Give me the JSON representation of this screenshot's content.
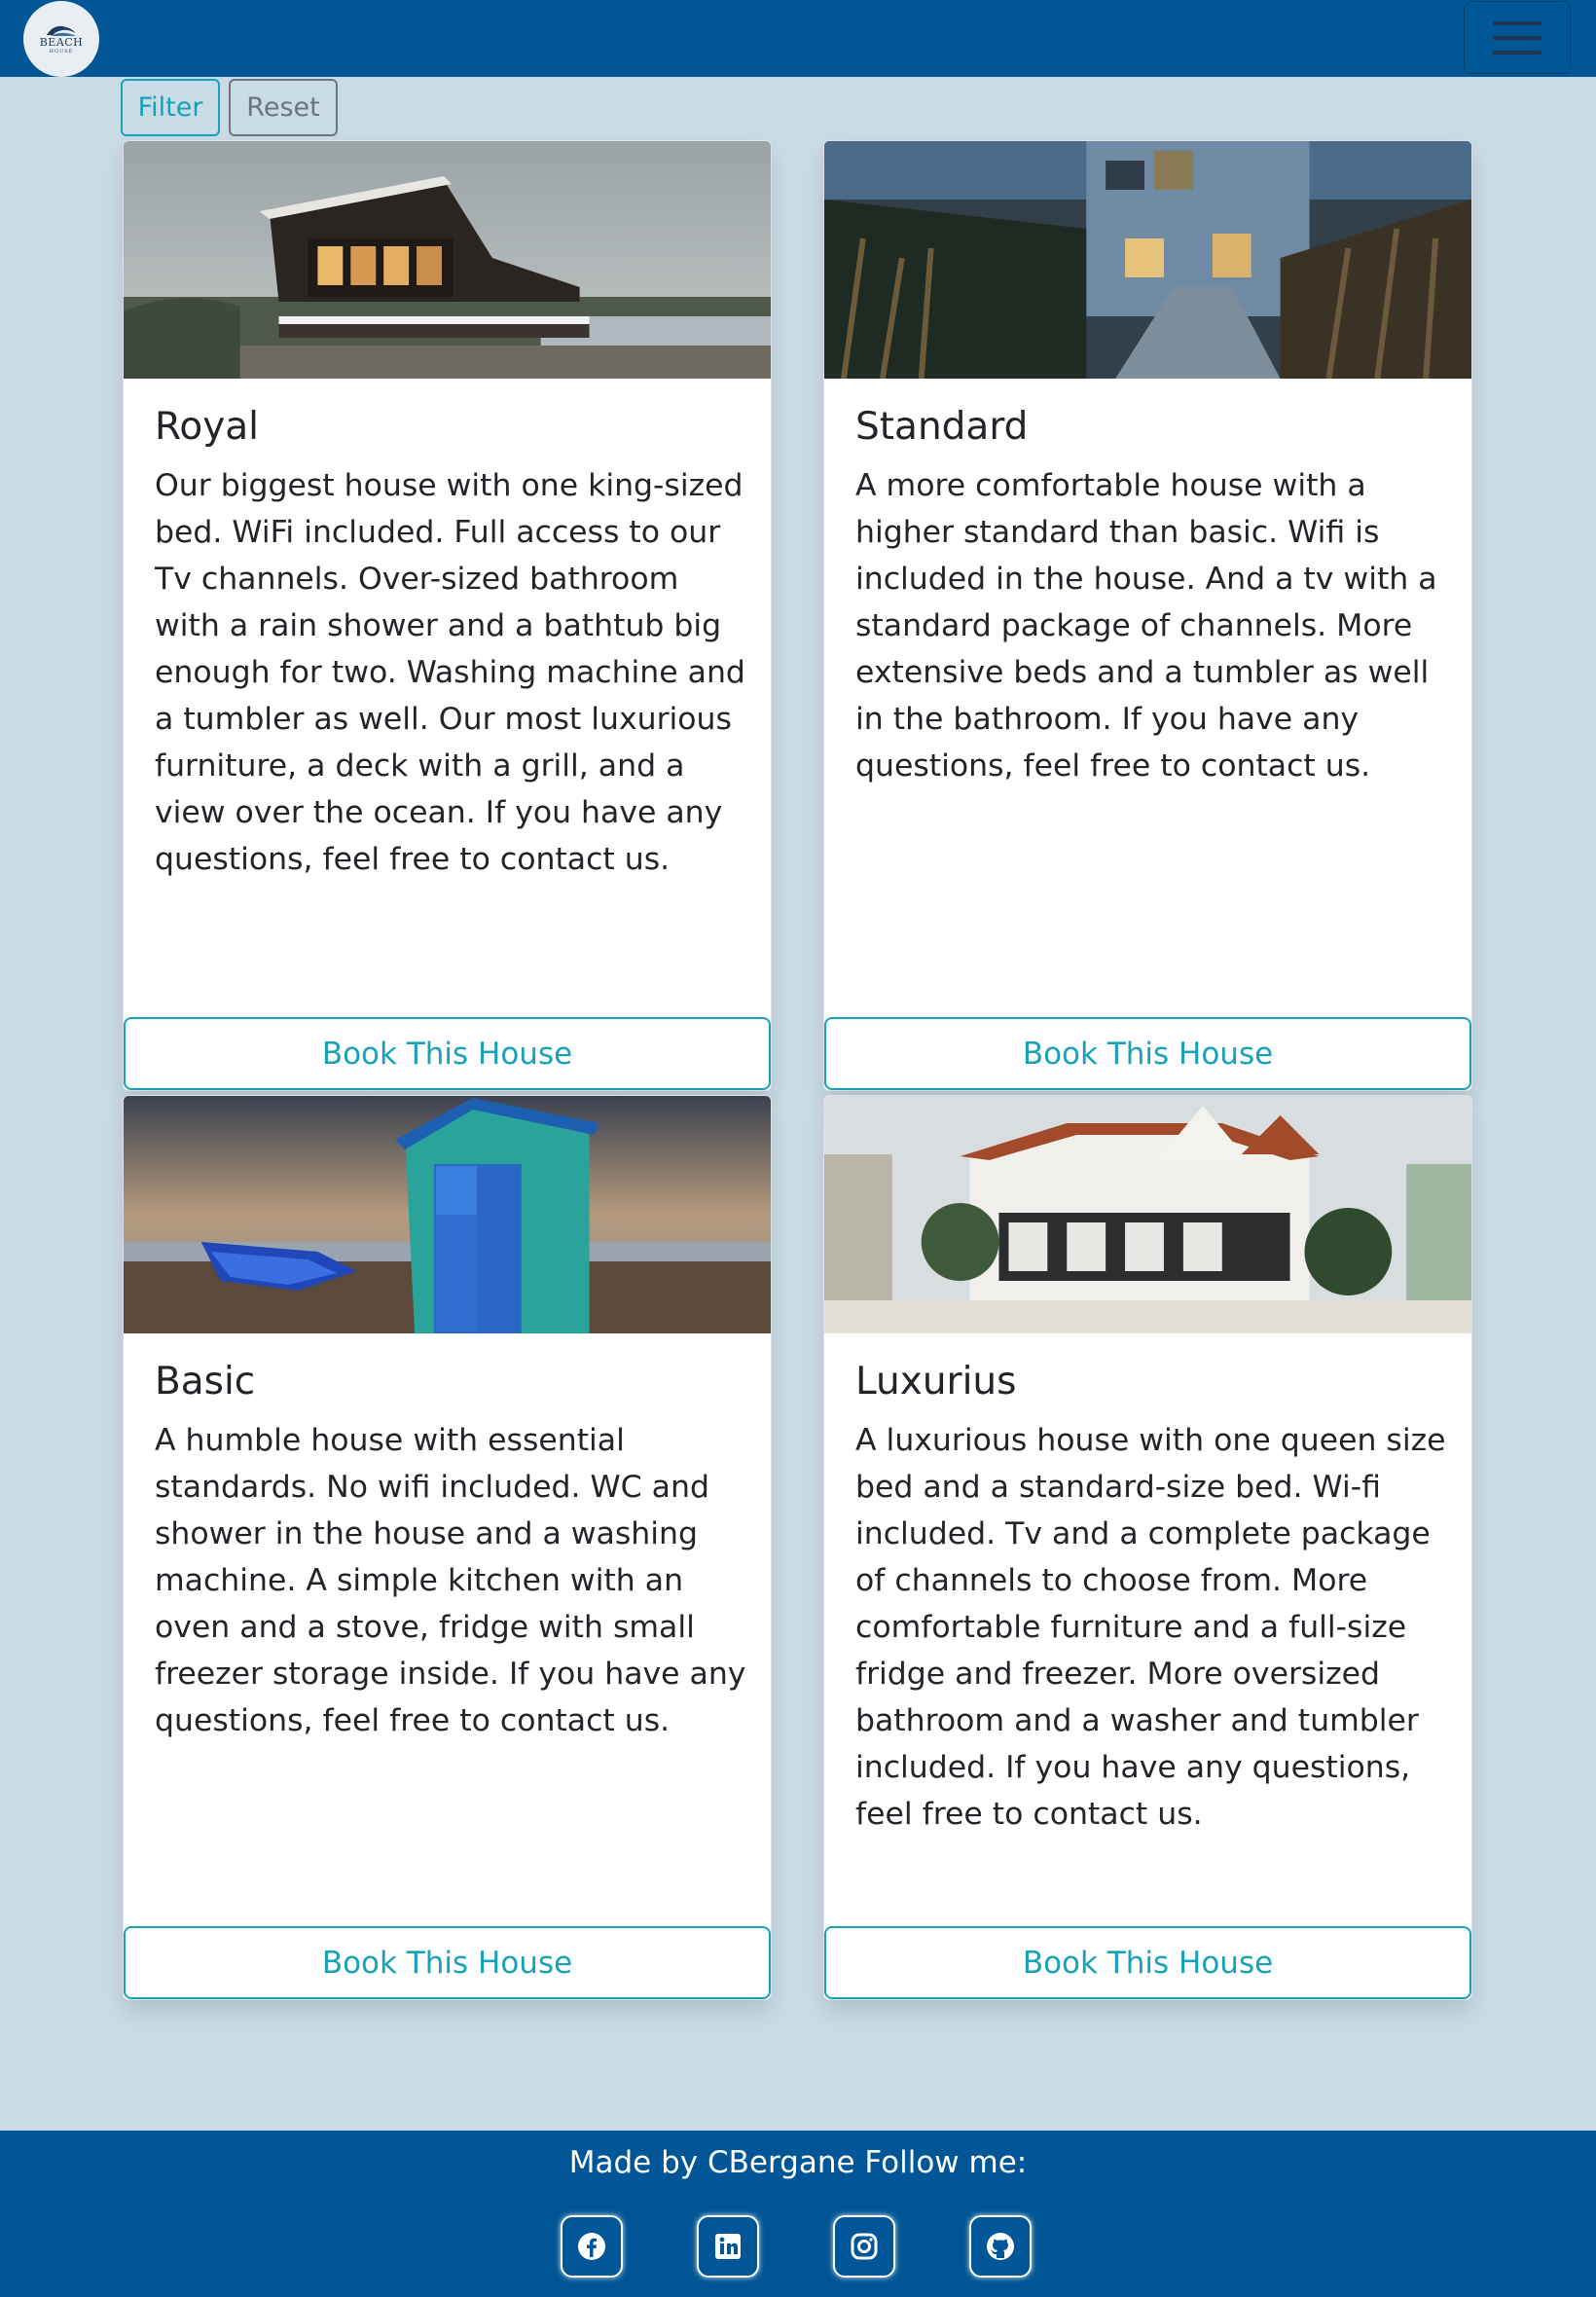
{
  "navbar": {
    "logo_text": "BEACH",
    "logo_subtext": "HOUSE",
    "toggle_icon": "hamburger-menu-icon"
  },
  "filters": {
    "filter_label": "Filter",
    "reset_label": "Reset"
  },
  "houses": [
    {
      "title": "Royal",
      "description": "Our biggest house with one king-sized bed. WiFi included. Full access to our Tv channels. Over-sized bathroom with a rain shower and a bathtub big enough for two. Washing machine and a tumbler as well. Our most luxurious furniture, a deck with a grill, and a view over the ocean. If you have any questions, feel free to contact us.",
      "button_label": "Book This House"
    },
    {
      "title": "Standard",
      "description": "A more comfortable house with a higher standard than basic. Wifi is included in the house. And a tv with a standard package of channels. More extensive beds and a tumbler as well in the bathroom. If you have any questions, feel free to contact us.",
      "button_label": "Book This House"
    },
    {
      "title": "Basic",
      "description": "A humble house with essential standards. No wifi included. WC and shower in the house and a washing machine. A simple kitchen with an oven and a stove, fridge with small freezer storage inside. If you have any questions, feel free to contact us.",
      "button_label": "Book This House"
    },
    {
      "title": "Luxurius",
      "description": "A luxurious house with one queen size bed and a standard-size bed. Wi-fi included. Tv and a complete package of channels to choose from. More comfortable furniture and a full-size fridge and freezer. More oversized bathroom and a washer and tumbler included. If you have any questions, feel free to contact us.",
      "button_label": "Book This House"
    }
  ],
  "footer": {
    "credit": "Made by CBergane Follow me:",
    "social_icons": [
      "facebook-icon",
      "linkedin-icon",
      "instagram-icon",
      "github-icon"
    ]
  },
  "colors": {
    "navbar": "#005696",
    "page_background": "#c9dce6",
    "accent": "#17a2b8",
    "secondary": "#6c757d"
  }
}
